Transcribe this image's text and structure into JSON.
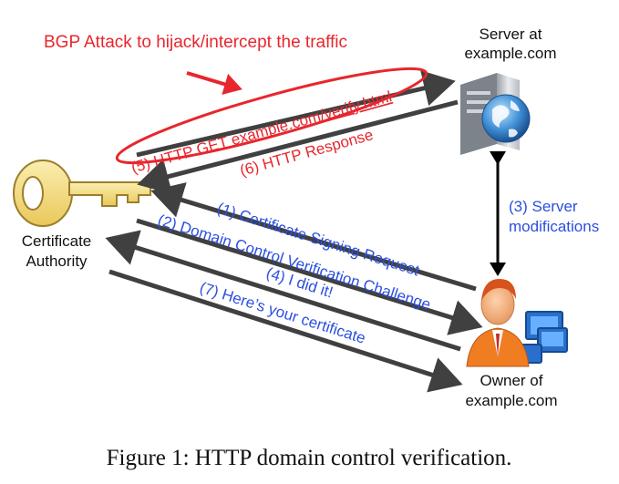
{
  "attack": {
    "title": "BGP Attack to hijack/intercept the traffic",
    "color": "#e8262d"
  },
  "nodes": {
    "server": {
      "line1": "Server at",
      "line2": "example.com",
      "icon": "server-globe-icon"
    },
    "ca": {
      "line1": "Certificate",
      "line2": "Authority",
      "icon": "key-icon"
    },
    "owner": {
      "line1": "Owner of",
      "line2": "example.com",
      "icon": "person-computers-icon"
    }
  },
  "steps": {
    "s1": "(1) Certificate Signing Request",
    "s2": "(2) Domain Control Verification Challenge",
    "s3_line1": "(3) Server",
    "s3_line2": "modifications",
    "s4": "(4) I did it!",
    "s5_prefix": "(5) HTTP GET ",
    "s5_url": "example.com/verify.html",
    "s6": "(6) HTTP Response",
    "s7": "(7) Here’s your certificate"
  },
  "caption": "Figure 1: HTTP domain control verification.",
  "colors": {
    "step_text": "#2b4fe0",
    "attack_text": "#e8262d",
    "arrow": "#404040",
    "key": "#f3dc7a"
  }
}
